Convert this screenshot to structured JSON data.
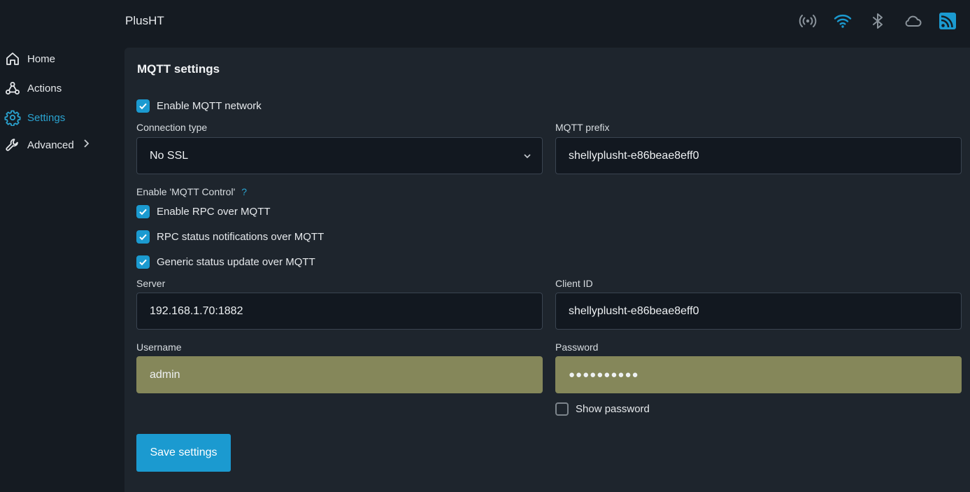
{
  "app": {
    "title": "PlusHT"
  },
  "status_icons": [
    "signal-icon",
    "wifi-icon",
    "bluetooth-icon",
    "cloud-icon",
    "rss-icon"
  ],
  "colors": {
    "accent": "#1b9ad0",
    "background": "#151b22",
    "panel": "#1e252d",
    "autofill": "#85875a"
  },
  "sidebar": {
    "items": [
      {
        "label": "Home",
        "icon": "home-icon"
      },
      {
        "label": "Actions",
        "icon": "webhook-icon"
      },
      {
        "label": "Settings",
        "icon": "gear-icon",
        "active": true
      },
      {
        "label": "Advanced",
        "icon": "wrench-icon"
      }
    ]
  },
  "mqtt": {
    "title": "MQTT settings",
    "enable_label": "Enable MQTT network",
    "enable_checked": true,
    "connection_type_label": "Connection type",
    "connection_type_value": "No SSL",
    "prefix_label": "MQTT prefix",
    "prefix_value": "shellyplusht-e86beae8eff0",
    "control_label": "Enable 'MQTT Control'",
    "help": "?",
    "rpc_label": "Enable RPC over MQTT",
    "rpc_status_label": "RPC status notifications over MQTT",
    "generic_label": "Generic status update over MQTT",
    "server_label": "Server",
    "server_value": "192.168.1.70:1882",
    "client_id_label": "Client ID",
    "client_id_value": "shellyplusht-e86beae8eff0",
    "username_label": "Username",
    "username_value": "admin",
    "password_label": "Password",
    "password_value": "●●●●●●●●●●",
    "show_password_label": "Show password",
    "show_password_checked": false,
    "save_label": "Save settings"
  }
}
